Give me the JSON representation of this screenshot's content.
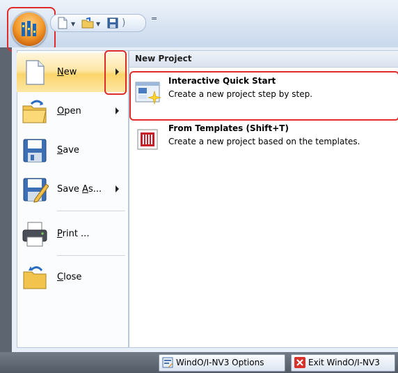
{
  "quick_access": {
    "separator": "="
  },
  "menu": {
    "items": [
      {
        "label": "New",
        "mnemonic": "N"
      },
      {
        "label": "Open",
        "mnemonic": "O"
      },
      {
        "label": "Save",
        "mnemonic": "S"
      },
      {
        "label": "Save As...",
        "mnemonic": "A"
      },
      {
        "label": "Print ...",
        "mnemonic": "P"
      },
      {
        "label": "Close",
        "mnemonic": "C"
      }
    ]
  },
  "submenu": {
    "header": "New Project",
    "items": [
      {
        "title": "Interactive Quick Start",
        "description": "Create a new project step by step."
      },
      {
        "title": "From Templates (Shift+T)",
        "description": "Create a new project based on the templates."
      }
    ]
  },
  "footer": {
    "options_label": "WindO/I-NV3 Options",
    "exit_label": "Exit WindO/I-NV3"
  },
  "colors": {
    "highlight": "#e02b2b",
    "hover": "#fbd56a",
    "orb": "#f49a2c"
  }
}
